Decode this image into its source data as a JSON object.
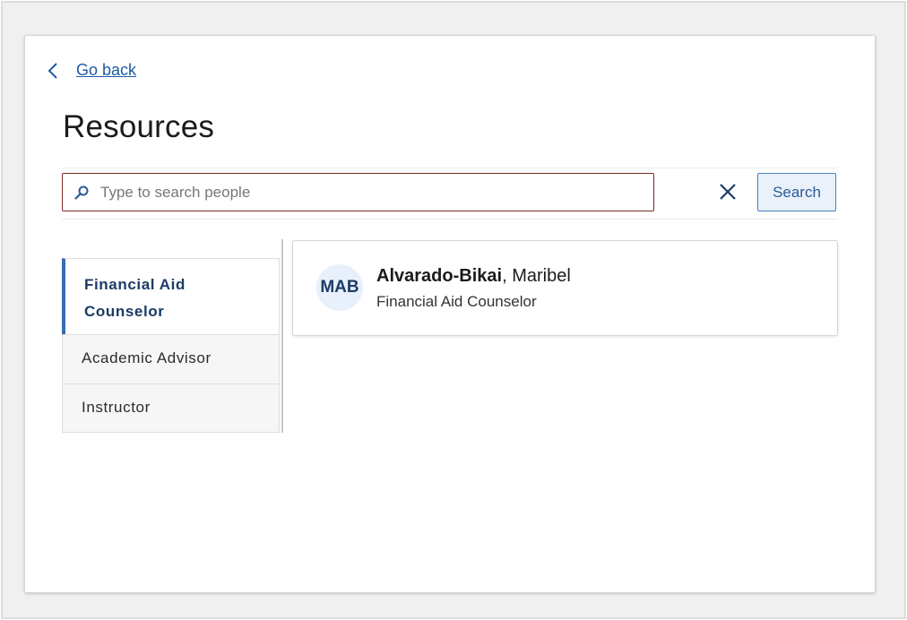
{
  "nav": {
    "back_label": "Go back"
  },
  "page": {
    "title": "Resources"
  },
  "search": {
    "placeholder": "Type to search people",
    "value": "",
    "button_label": "Search"
  },
  "roles": [
    {
      "label": "Financial Aid Counselor",
      "active": true
    },
    {
      "label": "Academic Advisor",
      "active": false
    },
    {
      "label": "Instructor",
      "active": false
    }
  ],
  "results": [
    {
      "initials": "MAB",
      "last_name": "Alvarado-Bikai",
      "separator": ", ",
      "first_name": "Maribel",
      "role": "Financial Aid Counselor"
    }
  ],
  "colors": {
    "link": "#1f5aa5",
    "accent": "#3a6db3",
    "search_border": "#7b2b23",
    "avatar_bg": "#e8f1fb"
  }
}
